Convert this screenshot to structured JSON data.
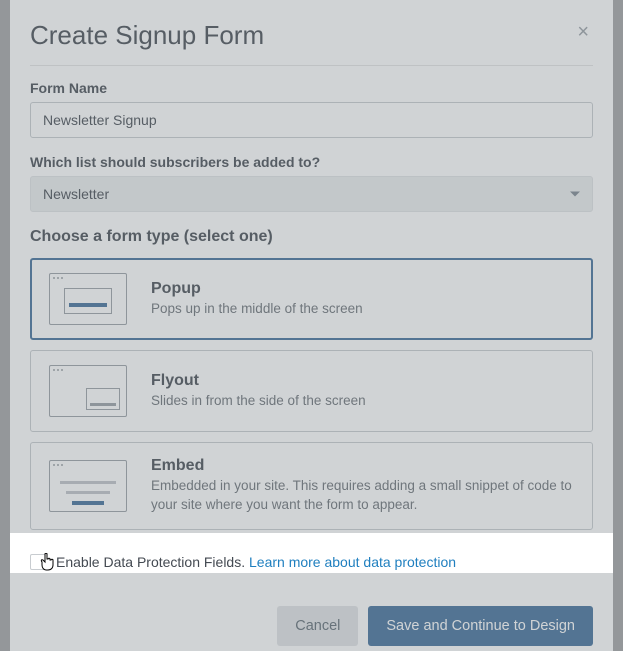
{
  "modal": {
    "title": "Create Signup Form",
    "close_label": "×"
  },
  "form_name": {
    "label": "Form Name",
    "value": "Newsletter Signup"
  },
  "list_select": {
    "label": "Which list should subscribers be added to?",
    "value": "Newsletter"
  },
  "form_type": {
    "heading": "Choose a form type (select one)",
    "options": [
      {
        "title": "Popup",
        "desc": "Pops up in the middle of the screen",
        "selected": true
      },
      {
        "title": "Flyout",
        "desc": "Slides in from the side of the screen",
        "selected": false
      },
      {
        "title": "Embed",
        "desc": "Embedded in your site. This requires adding a small snippet of code to your site where you want the form to appear.",
        "selected": false
      }
    ]
  },
  "data_protection": {
    "checked": false,
    "label_prefix": "Enable Data Protection Fields. ",
    "link_text": "Learn more about data protection"
  },
  "footer": {
    "cancel": "Cancel",
    "save": "Save and Continue to Design"
  }
}
